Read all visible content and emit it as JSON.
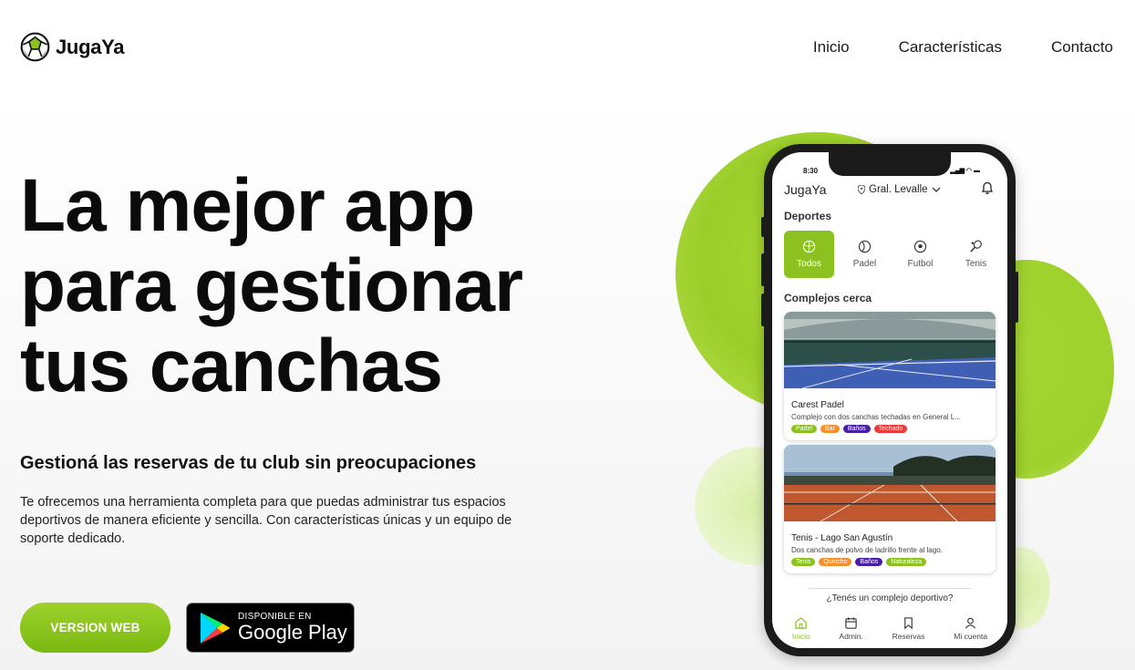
{
  "brand": {
    "name": "JugaYa"
  },
  "nav": {
    "items": [
      "Inicio",
      "Características",
      "Contacto"
    ]
  },
  "hero": {
    "title_lines": [
      "La mejor app",
      "para gestionar",
      "tus canchas"
    ],
    "subtitle": "Gestioná las reservas de tu club sin preocupaciones",
    "description": "Te ofrecemos una herramienta completa para que puedas administrar tus espacios deportivos de manera eficiente y sencilla. Con características únicas y un equipo de soporte dedicado.",
    "web_button": "VERSION WEB",
    "gplay": {
      "small": "DISPONIBLE EN",
      "big": "Google Play"
    }
  },
  "phone": {
    "status_time": "8:30",
    "status_icons": "▂▄▆ ◠ ▬",
    "app_logo": "JugaYa",
    "location": "Gral. Levalle",
    "sports_title": "Deportes",
    "sports": [
      {
        "label": "Todos",
        "icon": "ball-icon",
        "active": true
      },
      {
        "label": "Padel",
        "icon": "padel-icon",
        "active": false
      },
      {
        "label": "Futbol",
        "icon": "soccer-icon",
        "active": false
      },
      {
        "label": "Tenis",
        "icon": "tennis-icon",
        "active": false
      }
    ],
    "complexes_title": "Complejos cerca",
    "cards": [
      {
        "name": "Carest Padel",
        "desc": "Complejo con dos canchas techadas en General L...",
        "tags": [
          {
            "label": "Padel",
            "color": "#8cc21f"
          },
          {
            "label": "Bar",
            "color": "#f5902c"
          },
          {
            "label": "Baños",
            "color": "#4a1fa8"
          },
          {
            "label": "Techado",
            "color": "#ea3b3b"
          }
        ]
      },
      {
        "name": "Tenis - Lago San Agustín",
        "desc": "Dos canchas de polvo de ladrillo frente al lago.",
        "tags": [
          {
            "label": "Tenis",
            "color": "#8cc21f"
          },
          {
            "label": "Quincho",
            "color": "#f5902c"
          },
          {
            "label": "Baños",
            "color": "#4a1fa8"
          },
          {
            "label": "Naturaleza",
            "color": "#8cc21f"
          }
        ]
      }
    ],
    "question": "¿Tenés un complejo deportivo?",
    "tabs": [
      {
        "label": "Inicio",
        "icon": "home-icon",
        "active": true
      },
      {
        "label": "Admin.",
        "icon": "calendar-icon",
        "active": false
      },
      {
        "label": "Reservas",
        "icon": "bookmark-icon",
        "active": false
      },
      {
        "label": "Mi cuenta",
        "icon": "user-icon",
        "active": false
      }
    ]
  },
  "colors": {
    "accent": "#8cc21f",
    "accent_light": "#a5d62e"
  }
}
